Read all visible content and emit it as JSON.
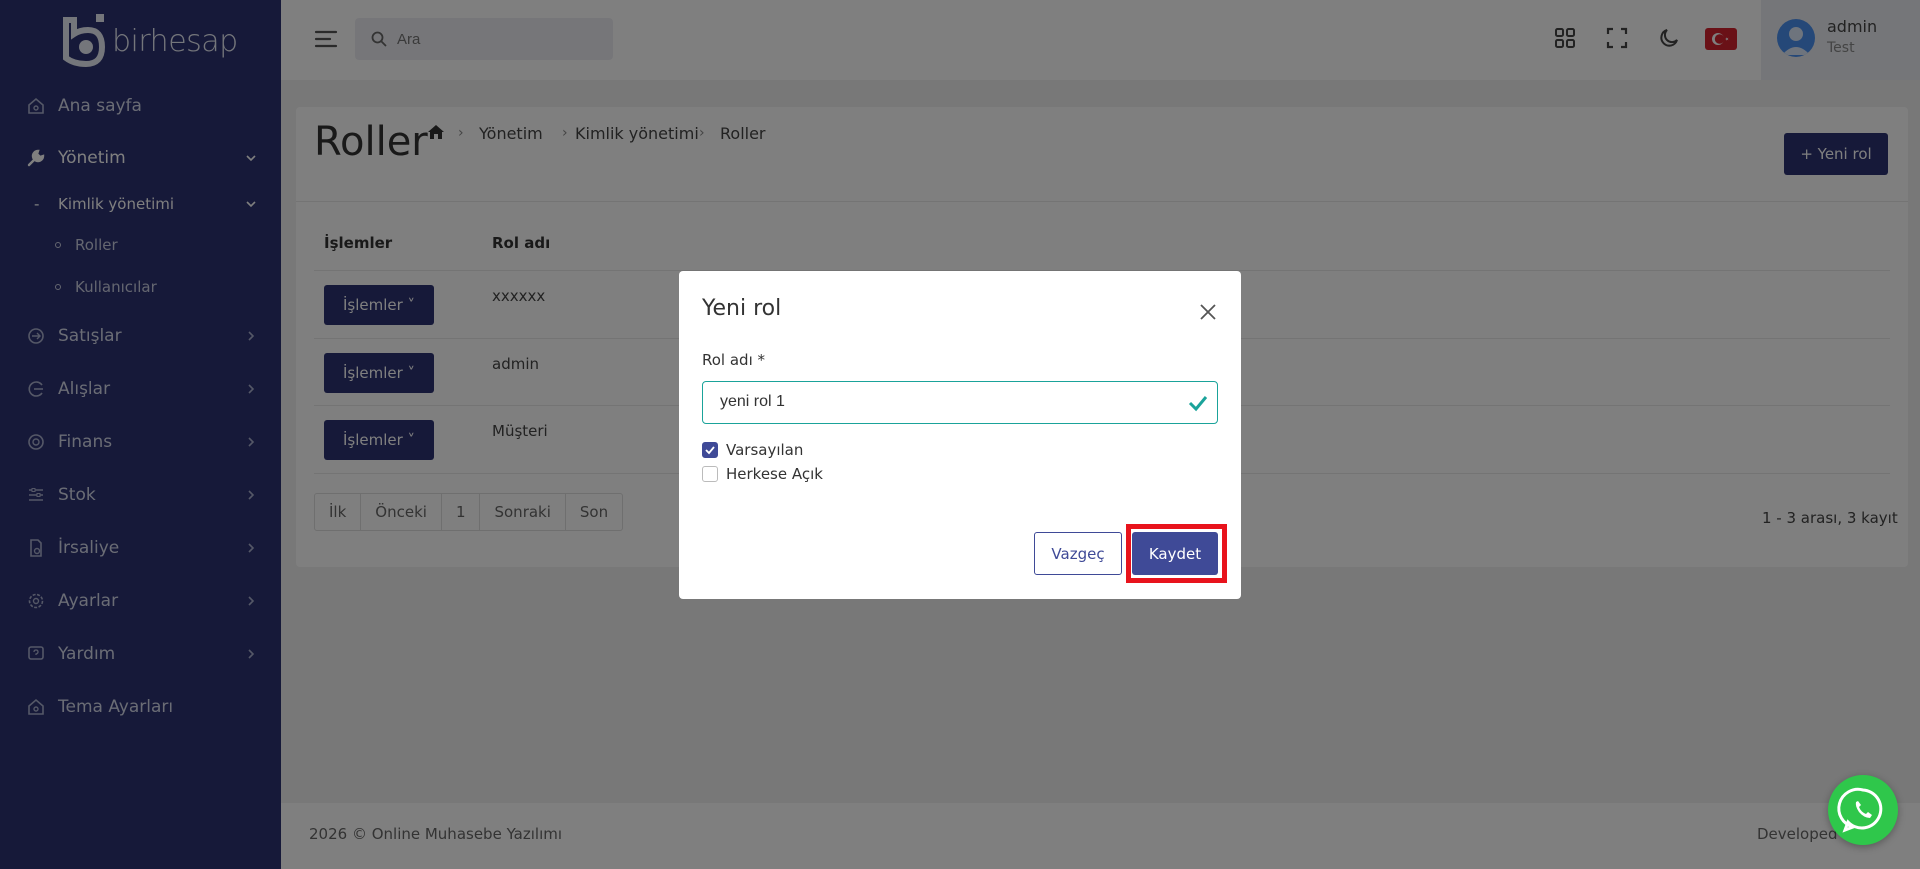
{
  "brand": {
    "name": "birhesap"
  },
  "sidebar": {
    "items": [
      {
        "label": "Ana sayfa"
      },
      {
        "label": "Yönetim"
      },
      {
        "label": "Satışlar"
      },
      {
        "label": "Alışlar"
      },
      {
        "label": "Finans"
      },
      {
        "label": "Stok"
      },
      {
        "label": "İrsaliye"
      },
      {
        "label": "Ayarlar"
      },
      {
        "label": "Yardım"
      },
      {
        "label": "Tema Ayarları"
      }
    ],
    "submenu": {
      "dash": "-",
      "label": "Kimlik yönetimi"
    },
    "subsubmenu": [
      {
        "label": "Roller"
      },
      {
        "label": "Kullanıcılar"
      }
    ]
  },
  "header": {
    "search_placeholder": "Ara",
    "user": {
      "name": "admin",
      "org": "Test"
    }
  },
  "page": {
    "title": "Roller",
    "breadcrumb": [
      "Yönetim",
      "Kimlik yönetimi",
      "Roller"
    ],
    "breadcrumb_sep": "›",
    "new_button": "+ Yeni rol",
    "table": {
      "headers": [
        "İşlemler",
        "Rol adı"
      ],
      "ops_label": "İşlemler ˅",
      "rows": [
        "xxxxxx",
        "admin",
        "Müşteri"
      ]
    },
    "pager": [
      "İlk",
      "Önceki",
      "1",
      "Sonraki",
      "Son"
    ],
    "page_info": "1 - 3 arası, 3 kayıt"
  },
  "footer": {
    "left": "2026 © Online Muhasebe Yazılımı",
    "right": "Developed"
  },
  "modal": {
    "title": "Yeni rol",
    "field_label": "Rol adı *",
    "field_value": "yeni rol 1",
    "checkboxes": [
      {
        "label": "Varsayılan",
        "checked": true
      },
      {
        "label": "Herkese Açık",
        "checked": false
      }
    ],
    "cancel": "Vazgeç",
    "save": "Kaydet"
  },
  "colors": {
    "sidebar": "#2c3272",
    "primary": "#3f4a97",
    "valid": "#1aa39a",
    "highlight": "#e8131c",
    "whatsapp": "#2fc74b"
  }
}
